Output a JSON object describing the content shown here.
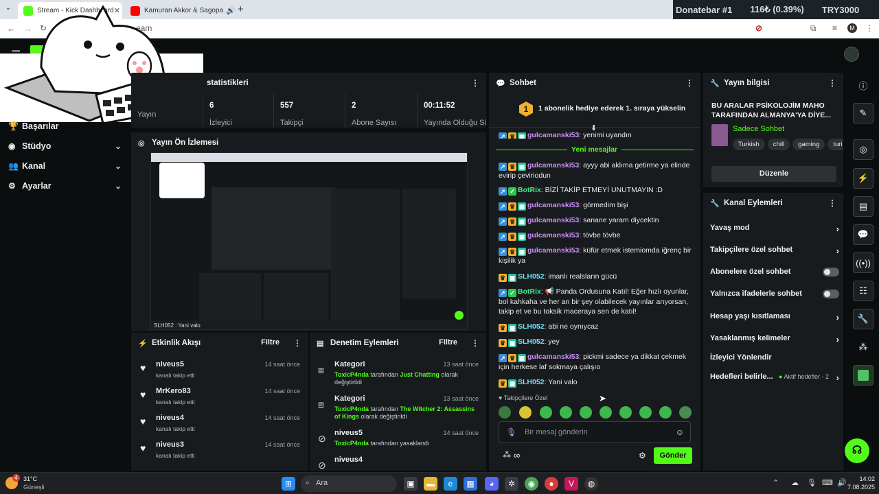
{
  "browser": {
    "tabs": [
      {
        "label": "Stream - Kick Dashboard"
      },
      {
        "label": "Kamuran Akkor & Sagopa"
      }
    ],
    "address": "eam",
    "profile_initial": "M"
  },
  "ticker": {
    "name": "Donatebar #1",
    "amount": "116₺ (0.39%)",
    "goal": "TRY3000"
  },
  "sidebar": {
    "items": [
      {
        "label": "Başarılar"
      },
      {
        "label": "Stüdyo"
      },
      {
        "label": "Kanal"
      },
      {
        "label": "Ayarlar"
      }
    ]
  },
  "stats": {
    "title": "statistikleri",
    "items": [
      {
        "value": "",
        "label": "Yayın"
      },
      {
        "value": "6",
        "label": "İzleyici"
      },
      {
        "value": "557",
        "label": "Takipçi"
      },
      {
        "value": "2",
        "label": "Abone Sayısı"
      },
      {
        "value": "00:11:52",
        "label": "Yayında Olduğu Süre"
      }
    ]
  },
  "preview": {
    "title": "Yayın Ön İzlemesi",
    "bottom_text": "SLH052 : Yani valo"
  },
  "activity": {
    "title": "Etkinlik Akışı",
    "filter": "Filtre",
    "items": [
      {
        "name": "niveus5",
        "sub": "kanalı takip etti",
        "time": "14 saat önce"
      },
      {
        "name": "MrKero83",
        "sub": "kanalı takip etti",
        "time": "14 saat önce"
      },
      {
        "name": "niveus4",
        "sub": "kanalı takip etti",
        "time": "14 saat önce"
      },
      {
        "name": "niveus3",
        "sub": "kanalı takip etti",
        "time": "14 saat önce"
      }
    ]
  },
  "moderation": {
    "title": "Denetim Eylemleri",
    "filter": "Filtre",
    "items": [
      {
        "name": "Kategori",
        "time": "13 saat önce",
        "actor": "ToxicP4nda",
        "mid": "tarafından",
        "target": "Just Chatting",
        "end": "olarak değiştirildi"
      },
      {
        "name": "Kategori",
        "time": "13 saat önce",
        "actor": "ToxicP4nda",
        "mid": "tarafından",
        "target": "The Witcher 2: Assassins of Kings",
        "end": "olarak değiştirildi"
      },
      {
        "name": "niveus5",
        "time": "14 saat önce",
        "actor": "ToxicP4nda",
        "mid": "tarafından yasaklandı",
        "target": "",
        "end": ""
      },
      {
        "name": "niveus4",
        "time": "14 saat önce",
        "actor": "",
        "mid": "",
        "target": "",
        "end": ""
      }
    ]
  },
  "chat": {
    "title": "Sohbet",
    "pinned_rank": "1",
    "pinned": "1 abonelik hediye ederek 1. sıraya yükselin",
    "partial_user": "gulcamanski53",
    "partial_text": ": yenimi uyandın",
    "new_messages": "Yeni mesajlar",
    "messages": [
      {
        "user": "gulcamanski53",
        "text": ": ayyy abi aklıma getirme ya elinde evirip çeviriodun"
      },
      {
        "user": "BotRix",
        "text": ": BİZİ TAKİP ETMEYİ UNUTMAYIN :D"
      },
      {
        "user": "gulcamanski53",
        "text": ": görmedim bişi"
      },
      {
        "user": "gulcamanski53",
        "text": ": sanane yaram diycektin"
      },
      {
        "user": "gulcamanski53",
        "text": ": tövbe tövbe"
      },
      {
        "user": "gulcamanski53",
        "text": ": küfür etmek istemiomda iğrenç bir kişilik ya"
      },
      {
        "user": "SLH052",
        "text": ": imanlı realsların gücü"
      },
      {
        "user": "BotRix",
        "text": ": 📢 Panda Ordusuna Katıl! Eğer hızlı oyunlar, bol kahkaha ve her an bir şey olabilecek yayınlar arıyorsan, takip et ve bu toksik maceraya sen de katıl!"
      },
      {
        "user": "SLH052",
        "text": ": abi ne oynıycaz"
      },
      {
        "user": "SLH052",
        "text": ": yey"
      },
      {
        "user": "gulcamanski53",
        "text": ": pickmi sadece ya dikkat çekmek için herkese laf sokmaya çalışıo"
      },
      {
        "user": "SLH052",
        "text": ": Yani valo"
      }
    ],
    "followers_only": "Takipçilere Özel",
    "placeholder": "Bir mesaj gönderin",
    "send": "Gönder"
  },
  "stream_info": {
    "title": "Yayın bilgisi",
    "stream_title": "BU ARALAR PSİKOLOJİM MAHO TARAFINDAN ALMANYA'YA DİYE...",
    "category": "Sadece Sohbet",
    "tags": [
      "Turkish",
      "chill",
      "gaming",
      "turi"
    ],
    "edit": "Düzenle"
  },
  "channel_actions": {
    "title": "Kanal Eylemleri",
    "items": [
      {
        "label": "Yavaş mod",
        "control": "chevron"
      },
      {
        "label": "Takipçilere özel sohbet",
        "control": "chevron"
      },
      {
        "label": "Abonelere özel sohbet",
        "control": "toggle"
      },
      {
        "label": "Yalnızca ifadelerle sohbet",
        "control": "toggle"
      },
      {
        "label": "Hesap yaşı kısıtlaması",
        "control": "chevron"
      },
      {
        "label": "Yasaklanmış kelimeler",
        "control": "chevron"
      },
      {
        "label": "İzleyici Yönlendir",
        "control": "none"
      }
    ],
    "goals_label": "Hedefleri belirle...",
    "goals_status": "Aktif hedefler - 2"
  },
  "taskbar": {
    "temp": "31°C",
    "weather": "Güneşli",
    "weather_badge": "4",
    "search": "Ara",
    "time": "14:02",
    "date": "7.08.2025"
  },
  "colors": {
    "accent": "#53fc18",
    "panel": "#181b1e",
    "background": "#0b0e0f"
  }
}
